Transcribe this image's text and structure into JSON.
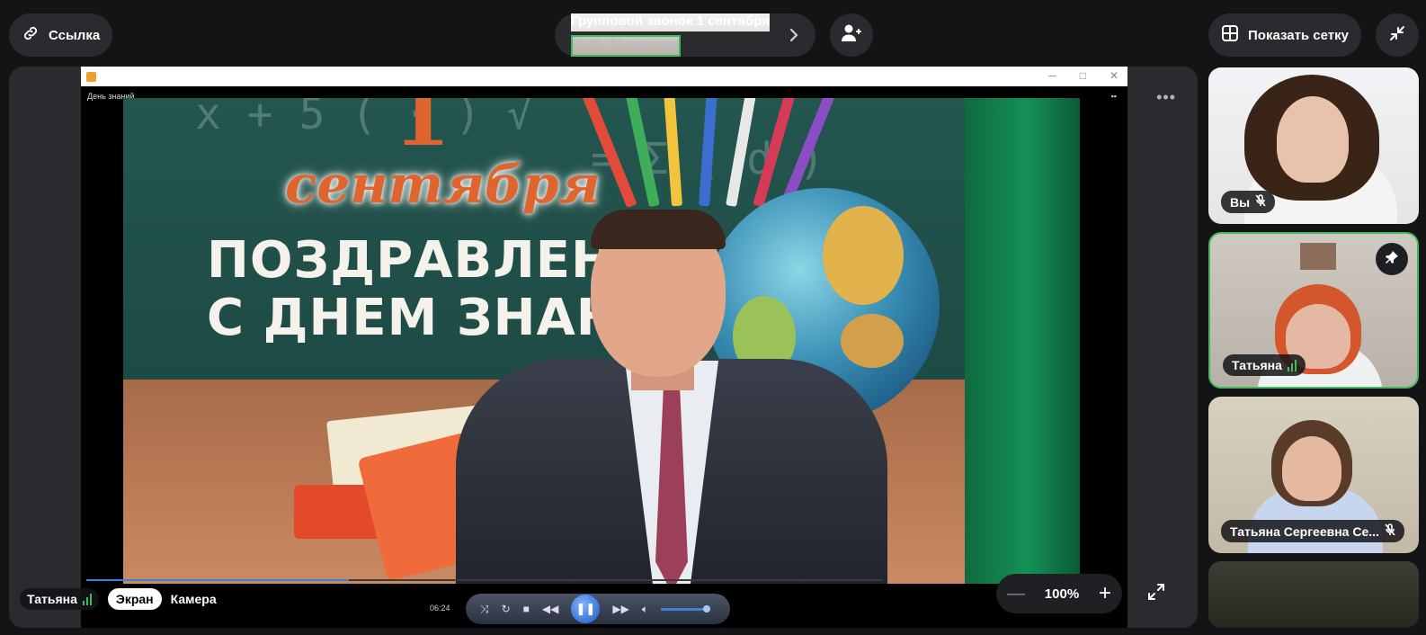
{
  "header": {
    "link_label": "Ссылка",
    "call_title": "Групповой звонок 1 сентября",
    "call_meta": "20:48 · 54 участника",
    "grid_label": "Показать сетку"
  },
  "shared_screen": {
    "document_title": "День знаний",
    "video_title_number": "1",
    "video_title_month": "сентября",
    "video_line1": "ПОЗДРАВЛЕНИЕ",
    "video_line2": "С ДНЕМ ЗНАНИЙ",
    "current_time": "06:24",
    "progress": 0.33
  },
  "stage_controls": {
    "zoom_minus": "—",
    "zoom_value": "100%",
    "zoom_plus": "+"
  },
  "presenter": {
    "name": "Татьяна",
    "tab_screen": "Экран",
    "tab_camera": "Камера"
  },
  "participants": [
    {
      "name": "Вы",
      "muted": true
    },
    {
      "name": "Татьяна",
      "speaking": true,
      "pinned": true
    },
    {
      "name": "Татьяна Сергеевна Се...",
      "muted": true
    }
  ],
  "colors": {
    "accent_green": "#3dbb5d",
    "background": "#141417",
    "panel": "#2a2b2f"
  }
}
